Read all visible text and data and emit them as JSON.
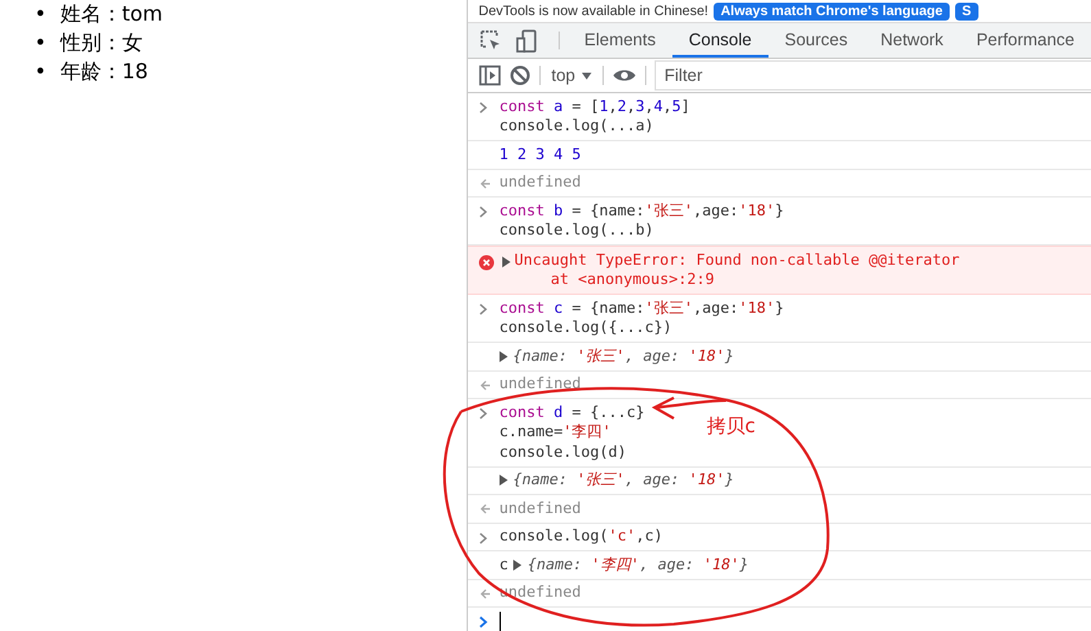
{
  "page": {
    "list_items": [
      {
        "marker": "•",
        "label": "姓名：",
        "value": "tom"
      },
      {
        "marker": "•",
        "label": "性别：",
        "value": "女"
      },
      {
        "marker": "•",
        "label": "年龄：",
        "value": "18"
      }
    ]
  },
  "devtools": {
    "notice": {
      "text": "DevTools is now available in Chinese!",
      "buttons": [
        "Always match Chrome's language",
        "S"
      ]
    },
    "tabs": [
      {
        "label": "Elements",
        "selected": false
      },
      {
        "label": "Console",
        "selected": true
      },
      {
        "label": "Sources",
        "selected": false
      },
      {
        "label": "Network",
        "selected": false
      },
      {
        "label": "Performance",
        "selected": false
      }
    ],
    "context": "top",
    "filter": {
      "placeholder": "Filter"
    },
    "console": [
      {
        "kind": "input",
        "lines": [
          "const a = [1,2,3,4,5]",
          "console.log(...a)"
        ]
      },
      {
        "kind": "log",
        "text": "1 2 3 4 5"
      },
      {
        "kind": "result",
        "text": "undefined"
      },
      {
        "kind": "input",
        "lines": [
          "const b = {name:'张三',age:'18'}",
          "console.log(...b)"
        ]
      },
      {
        "kind": "error",
        "lines": [
          "Uncaught TypeError: Found non-callable @@iterator",
          "    at <anonymous>:2:9"
        ]
      },
      {
        "kind": "input",
        "lines": [
          "const c = {name:'张三',age:'18'}",
          "console.log({...c})"
        ]
      },
      {
        "kind": "object",
        "text": "{name: '张三', age: '18'}"
      },
      {
        "kind": "result",
        "text": "undefined"
      },
      {
        "kind": "input",
        "lines": [
          "const d = {...c}",
          "c.name='李四'",
          "console.log(d)"
        ]
      },
      {
        "kind": "object",
        "text": "{name: '张三', age: '18'}"
      },
      {
        "kind": "result",
        "text": "undefined"
      },
      {
        "kind": "input",
        "lines": [
          "console.log('c',c)"
        ]
      },
      {
        "kind": "object",
        "prefix": "c",
        "text": "{name: '李四', age: '18'}"
      },
      {
        "kind": "result",
        "text": "undefined"
      },
      {
        "kind": "prompt"
      }
    ]
  },
  "annotation": {
    "text": "拷贝c"
  }
}
